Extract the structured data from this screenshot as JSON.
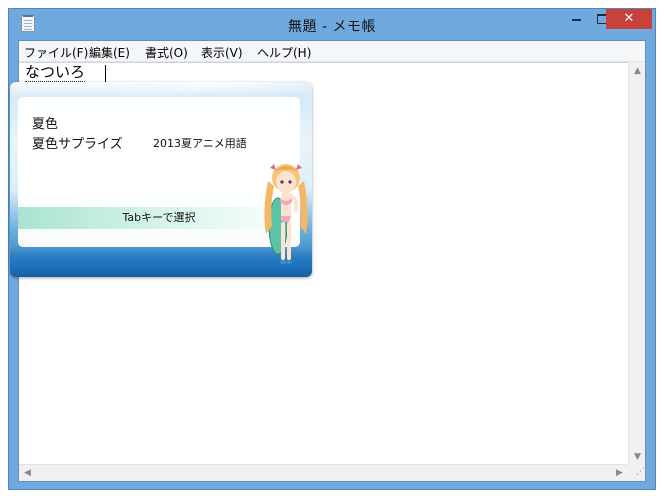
{
  "window": {
    "title": "無題 - メモ帳",
    "close_glyph": "✕"
  },
  "menu": {
    "items": [
      "ファイル(F)",
      "編集(E)",
      "書式(O)",
      "表示(V)",
      "ヘルプ(H)"
    ]
  },
  "editor": {
    "text": "なついろ"
  },
  "ime": {
    "candidates": [
      {
        "text": "夏色",
        "note": ""
      },
      {
        "text": "夏色サプライズ",
        "note": "2013夏アニメ用語"
      }
    ],
    "hint": "Tabキーで選択"
  },
  "scroll": {
    "up": "▲",
    "down": "▼",
    "left": "◀",
    "right": "▶",
    "grip": "⋰"
  },
  "colors": {
    "titlebar": "#6fa9de",
    "close_button": "#c7423a",
    "hint_bar": "#a9e3d2"
  }
}
